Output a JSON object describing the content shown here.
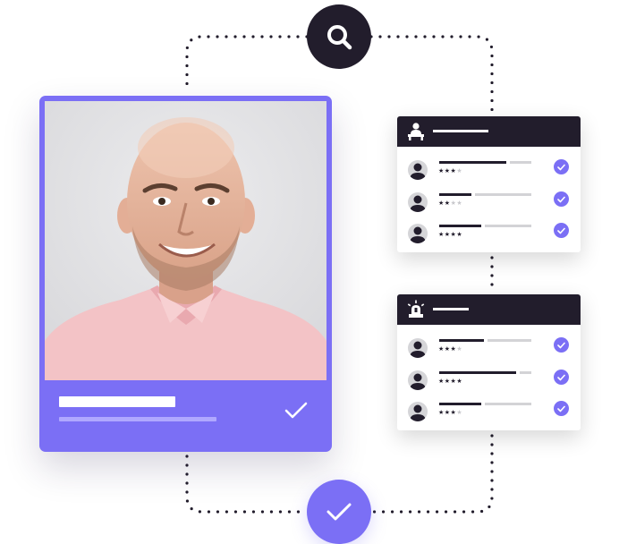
{
  "colors": {
    "accent": "#7b6ff5",
    "dark": "#221d2c",
    "placeholder_light": "#d3d3d6",
    "accent_light": "#b0a8ff"
  },
  "search": {
    "icon": "search-icon"
  },
  "verify": {
    "icon": "check-icon"
  },
  "profile_card": {
    "photo": "portrait-photo",
    "check_icon": "check-icon"
  },
  "panels": [
    {
      "icon": "person-at-desk-icon",
      "rows": [
        {
          "rating": 3,
          "max": 4
        },
        {
          "rating": 2,
          "max": 4
        },
        {
          "rating": 4,
          "max": 4
        }
      ]
    },
    {
      "icon": "alarm-light-icon",
      "rows": [
        {
          "rating": 3,
          "max": 4
        },
        {
          "rating": 4,
          "max": 4
        },
        {
          "rating": 3,
          "max": 4
        }
      ]
    }
  ]
}
